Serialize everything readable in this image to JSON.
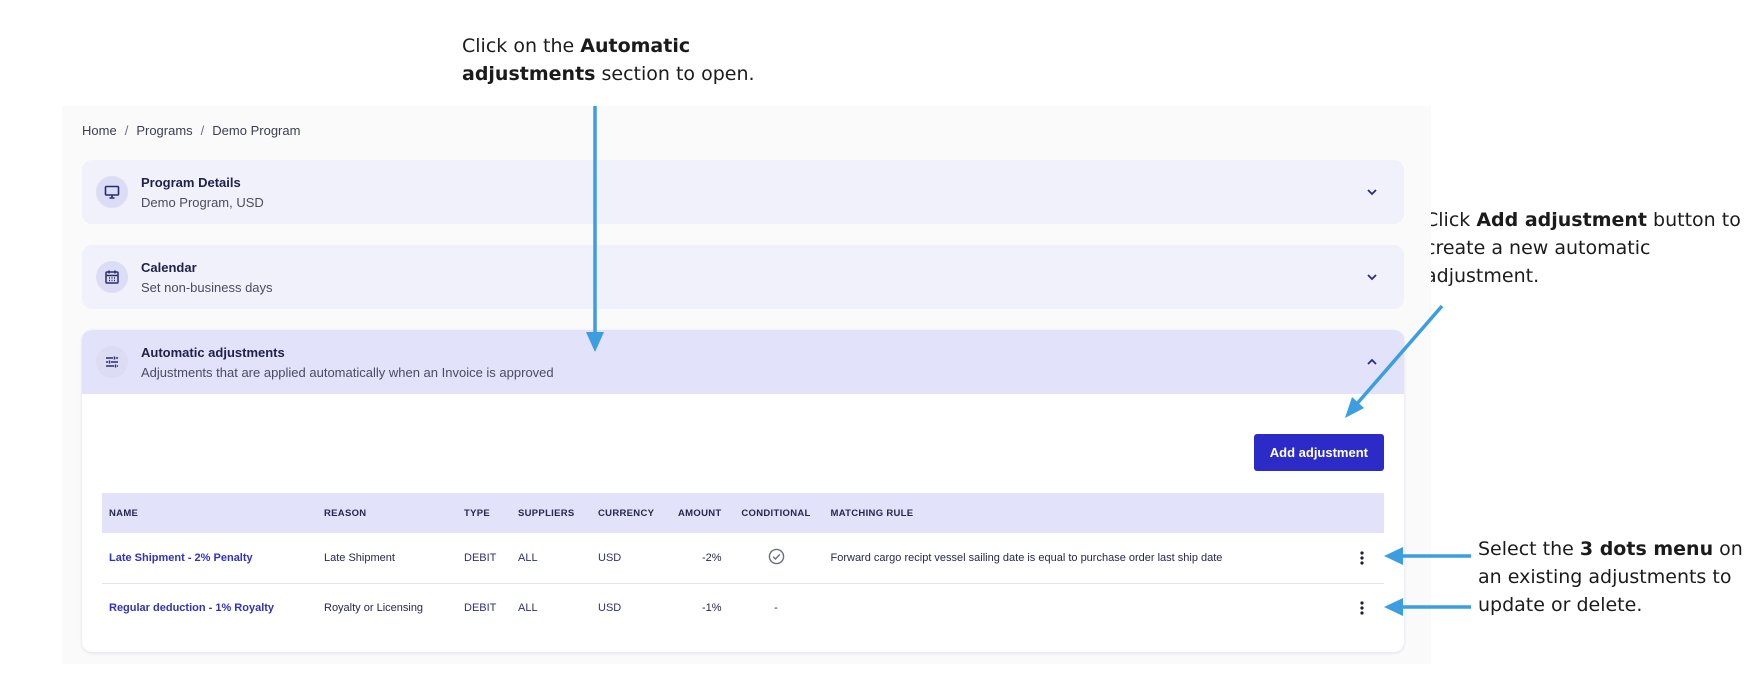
{
  "annotations": {
    "top": {
      "pre": "Click on the ",
      "bold": "Automatic adjustments",
      "post": " section to open."
    },
    "right": {
      "pre": " Click ",
      "bold": "Add adjustment",
      "post": " button to create a new automatic adjustment."
    },
    "bottom": {
      "pre": "Select the ",
      "bold": "3 dots menu",
      "post": " on an existing adjustments to update or delete."
    },
    "arrow_color": "#3a9ee0"
  },
  "breadcrumb": {
    "items": [
      "Home",
      "Programs",
      "Demo Program"
    ],
    "separator": "/"
  },
  "sections": {
    "program": {
      "title": "Program Details",
      "subtitle": "Demo Program, USD",
      "icon": "monitor-icon"
    },
    "calendar": {
      "title": "Calendar",
      "subtitle": "Set non-business days",
      "icon": "calendar-icon"
    },
    "auto": {
      "title": "Automatic adjustments",
      "subtitle": "Adjustments that are applied automatically when an Invoice is approved",
      "icon": "sliders-icon"
    }
  },
  "add_button_label": "Add adjustment",
  "table": {
    "headers": {
      "name": "NAME",
      "reason": "REASON",
      "type": "TYPE",
      "suppliers": "SUPPLIERS",
      "currency": "CURRENCY",
      "amount": "AMOUNT",
      "conditional": "CONDITIONAL",
      "rule": "MATCHING RULE"
    },
    "rows": [
      {
        "name": "Late Shipment - 2% Penalty",
        "reason": "Late Shipment",
        "type": "DEBIT",
        "suppliers": "ALL",
        "currency": "USD",
        "amount": "-2%",
        "conditional": "",
        "rule": "Forward cargo recipt vessel sailing date is equal to purchase order last ship date"
      },
      {
        "name": "Regular deduction - 1% Royalty",
        "reason": "Royalty or Licensing",
        "type": "DEBIT",
        "suppliers": "ALL",
        "currency": "USD",
        "amount": "-1%",
        "conditional": "-",
        "rule": ""
      }
    ]
  },
  "colors": {
    "accent": "#2d2bc7",
    "header_bg": "#e2e2fb",
    "link": "#3231c2"
  }
}
